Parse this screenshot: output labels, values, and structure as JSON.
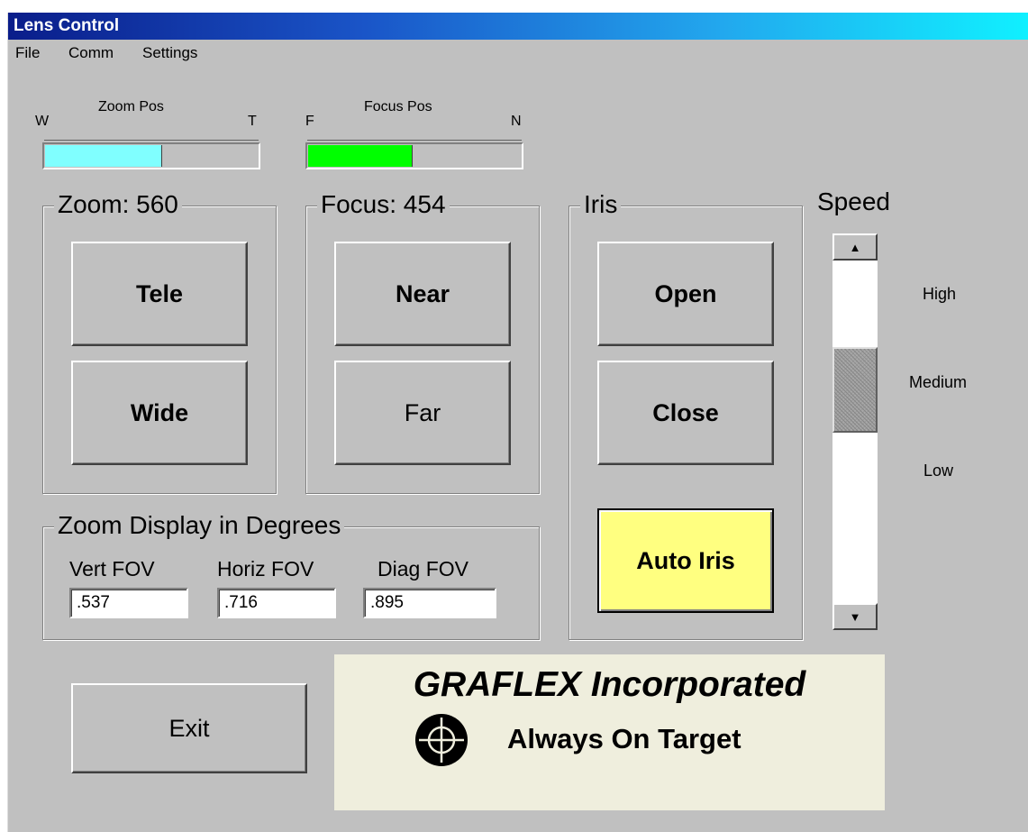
{
  "window": {
    "title": "Lens Control"
  },
  "menu": {
    "file": "File",
    "comm": "Comm",
    "settings": "Settings"
  },
  "zoom_meter": {
    "title": "Zoom Pos",
    "left_label": "W",
    "right_label": "T",
    "fill_fraction": 0.55,
    "fill_color": "#80ffff"
  },
  "focus_meter": {
    "title": "Focus Pos",
    "left_label": "F",
    "right_label": "N",
    "fill_fraction": 0.49,
    "fill_color": "#00ff00"
  },
  "zoom_group": {
    "title": "Zoom:  560",
    "tele": "Tele",
    "wide": "Wide"
  },
  "focus_group": {
    "title": "Focus:  454",
    "near": "Near",
    "far": "Far"
  },
  "iris_group": {
    "title": "Iris",
    "open": "Open",
    "close": "Close",
    "auto": "Auto Iris",
    "auto_color": "#ffff80"
  },
  "degrees_group": {
    "title": "Zoom Display in Degrees",
    "vert_label": "Vert FOV",
    "vert_value": ".537",
    "horiz_label": "Horiz FOV",
    "horiz_value": ".716",
    "diag_label": "Diag FOV",
    "diag_value": ".895"
  },
  "speed": {
    "title": "Speed",
    "high": "High",
    "medium": "Medium",
    "low": "Low",
    "setting": "Medium"
  },
  "exit_label": "Exit",
  "brand": {
    "name": "GRAFLEX Incorporated",
    "tagline": "Always On Target"
  }
}
